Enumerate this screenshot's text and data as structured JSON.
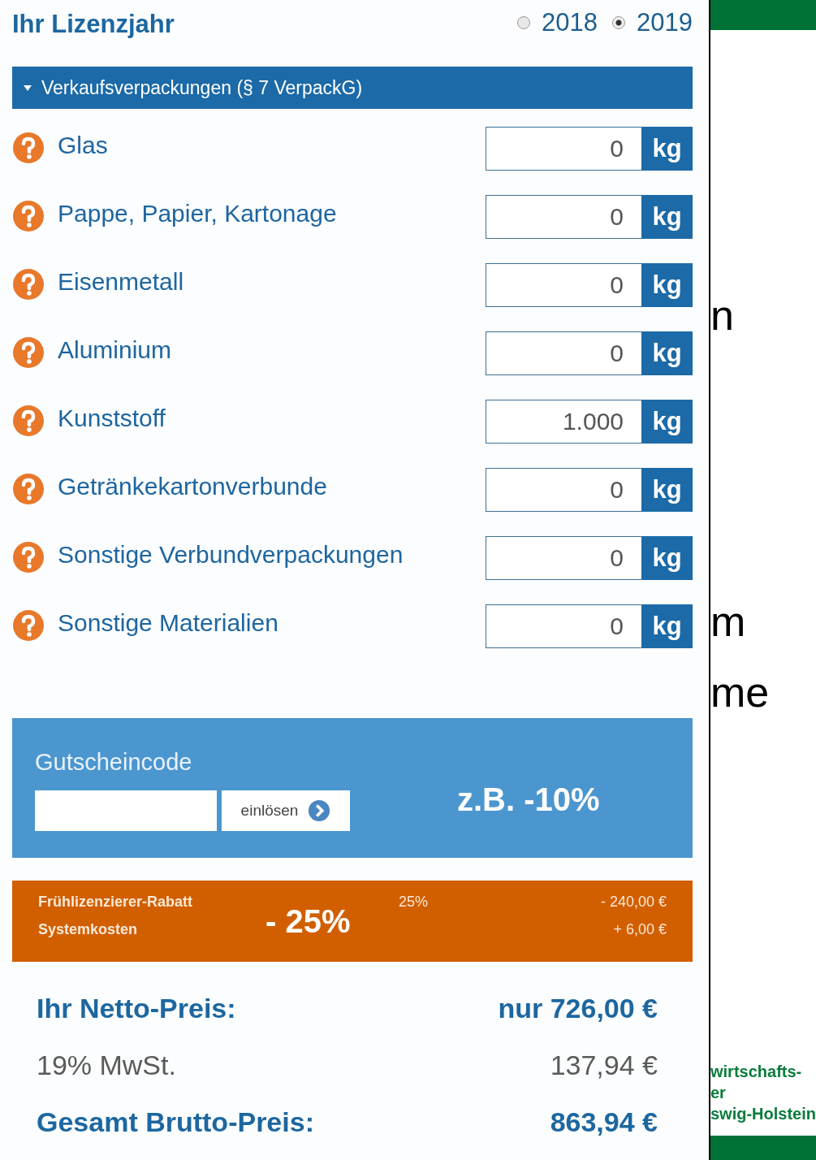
{
  "header": {
    "title": "Ihr Lizenzjahr",
    "years": [
      {
        "label": "2018",
        "selected": false
      },
      {
        "label": "2019",
        "selected": true
      }
    ]
  },
  "section": {
    "title": "Verkaufsverpackungen (§ 7 VerpackG)",
    "expanded": true
  },
  "materials": [
    {
      "name": "Glas",
      "value": "0",
      "unit": "kg"
    },
    {
      "name": "Pappe, Papier, Kartonage",
      "value": "0",
      "unit": "kg"
    },
    {
      "name": "Eisenmetall",
      "value": "0",
      "unit": "kg"
    },
    {
      "name": "Aluminium",
      "value": "0",
      "unit": "kg"
    },
    {
      "name": "Kunststoff",
      "value": "1.000",
      "unit": "kg"
    },
    {
      "name": "Getränkekartonverbunde",
      "value": "0",
      "unit": "kg"
    },
    {
      "name": "Sonstige Verbundverpackungen",
      "value": "0",
      "unit": "kg"
    },
    {
      "name": "Sonstige Materialien",
      "value": "0",
      "unit": "kg"
    }
  ],
  "voucher": {
    "label": "Gutscheincode",
    "button": "einlösen",
    "note": "z.B. -10%"
  },
  "discounts": {
    "note": "- 25%",
    "rows": [
      {
        "label": "Frühlizenzierer-Rabatt",
        "percent": "25%",
        "amount": "- 240,00 €"
      },
      {
        "label": "Systemkosten",
        "amount": "+ 6,00 €"
      }
    ]
  },
  "totals": [
    {
      "label": "Ihr Netto-Preis:",
      "value": "nur 726,00 €",
      "emphasis": true
    },
    {
      "label": "19% MwSt.",
      "value": "137,94 €",
      "emphasis": false
    },
    {
      "label": "Gesamt Brutto-Preis:",
      "value": "863,94 €",
      "emphasis": true
    }
  ],
  "background_slide": {
    "fragments": [
      "n",
      "m",
      "me"
    ],
    "footer_lines": [
      "wirtschafts-",
      "er",
      "swig-Holstein"
    ]
  }
}
